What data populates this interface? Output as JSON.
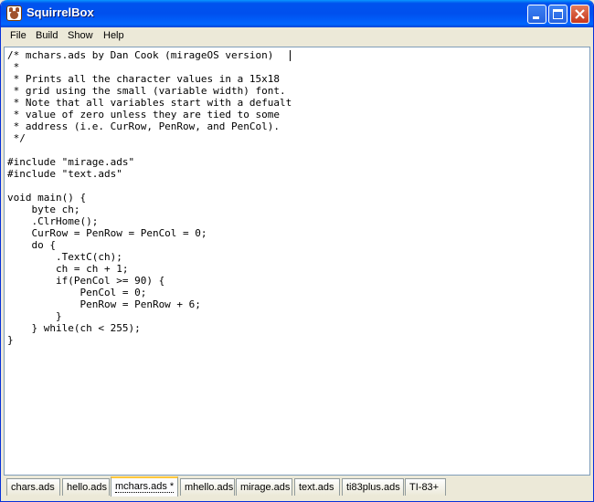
{
  "window": {
    "title": "SquirrelBox"
  },
  "menu": [
    "File",
    "Build",
    "Show",
    "Help"
  ],
  "editor": {
    "lines": [
      "/* mchars.ads by Dan Cook (mirageOS version)",
      " *",
      " * Prints all the character values in a 15x18",
      " * grid using the small (variable width) font.",
      " * Note that all variables start with a defualt",
      " * value of zero unless they are tied to some",
      " * address (i.e. CurRow, PenRow, and PenCol).",
      " */",
      "",
      "#include \"mirage.ads\"",
      "#include \"text.ads\"",
      "",
      "void main() {",
      "    byte ch;",
      "    .ClrHome();",
      "    CurRow = PenRow = PenCol = 0;",
      "    do {",
      "        .TextC(ch);",
      "        ch = ch + 1;",
      "        if(PenCol >= 90) {",
      "            PenCol = 0;",
      "            PenRow = PenRow + 6;",
      "        }",
      "    } while(ch < 255);",
      "}"
    ]
  },
  "tabs": [
    {
      "label": "chars.ads"
    },
    {
      "label": "hello.ads"
    },
    {
      "label": "mchars.ads *",
      "active": true
    },
    {
      "label": "mhello.ads"
    },
    {
      "label": "mirage.ads"
    },
    {
      "label": "text.ads"
    },
    {
      "label": "ti83plus.ads"
    },
    {
      "label": "TI-83+"
    }
  ]
}
